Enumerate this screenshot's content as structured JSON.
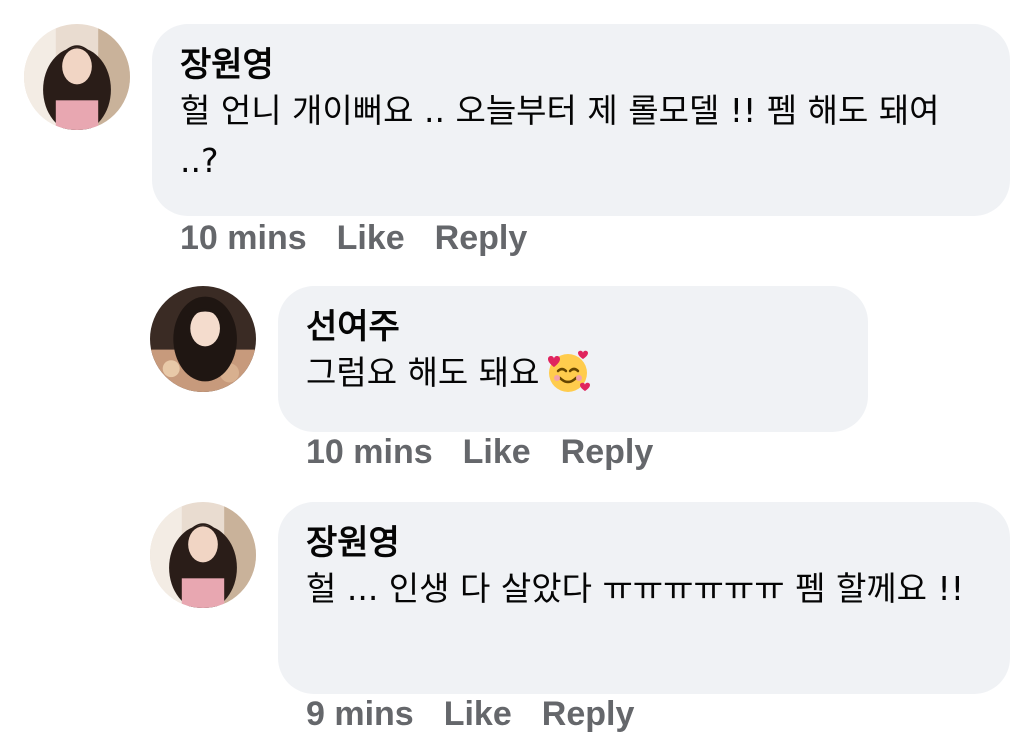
{
  "comments": [
    {
      "author": "장원영",
      "text": "헐 언니 개이뻐요 .. 오늘부터 제 롤모델 !! 펨 해도 돼여 ..?",
      "time": "10 mins",
      "like_label": "Like",
      "reply_label": "Reply"
    },
    {
      "author": "선여주",
      "text": "그럼요 해도 돼요",
      "emoji": "smiling-face-with-hearts-icon",
      "time": "10 mins",
      "like_label": "Like",
      "reply_label": "Reply"
    },
    {
      "author": "장원영",
      "text": "헐 ... 인생 다 살았다 ㅠㅠㅠㅠㅠㅠ 펨 할께요 !!",
      "time": "9 mins",
      "like_label": "Like",
      "reply_label": "Reply"
    }
  ],
  "colors": {
    "bubble": "#f0f2f5",
    "meta_text": "#65676b",
    "body_text": "#050505"
  }
}
